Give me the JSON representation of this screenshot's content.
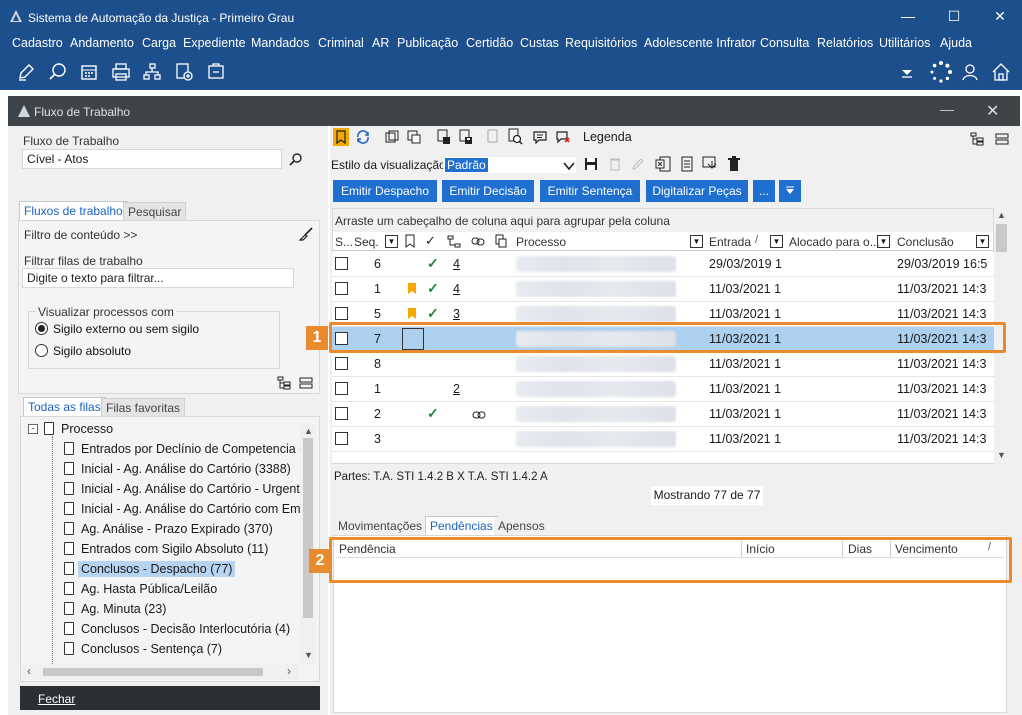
{
  "app": {
    "title": "Sistema de Automação da Justiça - Primeiro Grau"
  },
  "menu": [
    "Cadastro",
    "Andamento",
    "Carga",
    "Expediente",
    "Mandados",
    "Criminal",
    "AR",
    "Publicação",
    "Certidão",
    "Custas",
    "Requisitórios",
    "Adolescente Infrator",
    "Consulta",
    "Relatórios",
    "Utilitários",
    "Ajuda"
  ],
  "inner_window": {
    "title": "Fluxo de Trabalho"
  },
  "left": {
    "fluxo_label": "Fluxo de Trabalho",
    "fluxo_value": "Cível - Atos",
    "tabs": [
      "Fluxos de trabalho",
      "Pesquisar"
    ],
    "filtro_conteudo": "Filtro de conteúdo >>",
    "filtrar_label": "Filtrar filas de trabalho",
    "filtrar_placeholder": "Digite o texto para filtrar...",
    "visualizar_label": "Visualizar processos com",
    "radio1": "Sigilo externo ou sem sigilo",
    "radio2": "Sigilo absoluto",
    "queue_tabs": [
      "Todas as filas",
      "Filas favoritas"
    ],
    "tree_root": "Processo",
    "tree_items": [
      "Entrados por Declínio de Competencia - T",
      "Inicial - Ag. Análise do Cartório (3388)",
      "Inicial - Ag. Análise do Cartório - Urgente",
      "Inicial - Ag. Análise do Cartório com Emer",
      "Ag. Análise - Prazo Expirado (370)",
      "Entrados com Sigilo Absoluto (11)",
      "Conclusos - Despacho (77)",
      "Ag. Hasta Pública/Leilão",
      "Ag. Minuta (23)",
      "Conclusos - Decisão Interlocutória (4)",
      "Conclusos - Sentença (7)"
    ],
    "close": "Fechar"
  },
  "right": {
    "legend": "Legenda",
    "estilo_label": "Estilo da visualização",
    "estilo_value": "Padrão",
    "actions": [
      "Emitir Despacho",
      "Emitir Decisão",
      "Emitir Sentença",
      "Digitalizar Peças",
      "..."
    ],
    "group_hint": "Arraste um cabeçalho de coluna aqui para agrupar pela coluna",
    "columns": [
      "S...",
      "Seq.",
      "Processo",
      "Entrada",
      "Alocado para o...",
      "Conclusão"
    ],
    "rows": [
      {
        "seq": "6",
        "flag": false,
        "check": true,
        "num": "4",
        "entrada": "29/03/2019 1",
        "conclusao": "29/03/2019 16:5"
      },
      {
        "seq": "1",
        "flag": true,
        "check": true,
        "num": "4",
        "entrada": "11/03/2021 1",
        "conclusao": "11/03/2021 14:3"
      },
      {
        "seq": "5",
        "flag": true,
        "check": true,
        "num": "3",
        "entrada": "11/03/2021 1",
        "conclusao": "11/03/2021 14:3"
      },
      {
        "seq": "7",
        "flag": false,
        "check": false,
        "num": "",
        "entrada": "11/03/2021 1",
        "conclusao": "11/03/2021 14:3"
      },
      {
        "seq": "8",
        "flag": false,
        "check": false,
        "num": "",
        "entrada": "11/03/2021 1",
        "conclusao": "11/03/2021 14:3"
      },
      {
        "seq": "1",
        "flag": false,
        "check": false,
        "num": "2",
        "entrada": "11/03/2021 1",
        "conclusao": "11/03/2021 14:3"
      },
      {
        "seq": "2",
        "flag": false,
        "check": true,
        "num": "",
        "entrada": "11/03/2021 1",
        "conclusao": "11/03/2021 14:3"
      },
      {
        "seq": "3",
        "flag": false,
        "check": false,
        "num": "",
        "entrada": "11/03/2021 1",
        "conclusao": "11/03/2021 14:3"
      }
    ],
    "partes": "Partes: T.A. STI 1.4.2 B  X  T.A. STI 1.4.2 A",
    "mostrando": "Mostrando 77 de 77",
    "bottom_tabs": [
      "Movimentações",
      "Pendências",
      "Apensos"
    ],
    "pend_columns": [
      "Pendência",
      "Início",
      "Dias",
      "Vencimento"
    ],
    "badge1": "1",
    "badge2": "2"
  }
}
